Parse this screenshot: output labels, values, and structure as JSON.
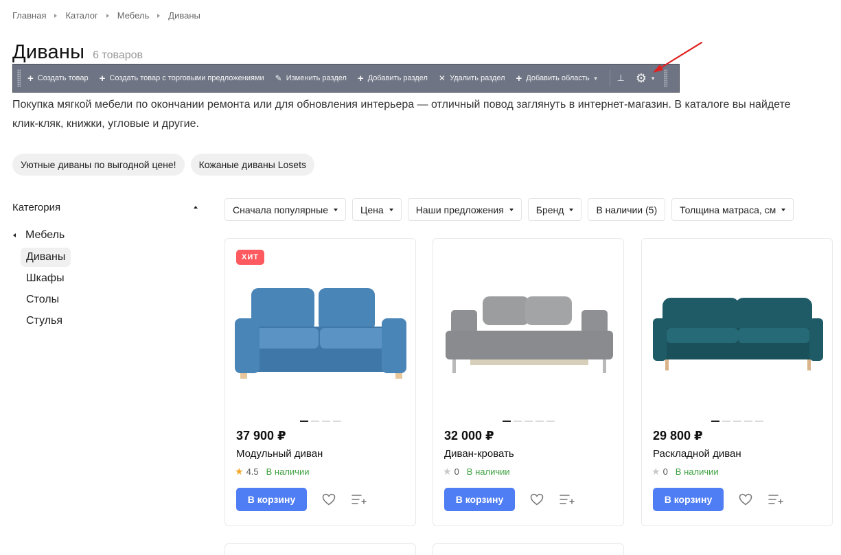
{
  "breadcrumb": [
    "Главная",
    "Каталог",
    "Мебель",
    "Диваны"
  ],
  "page": {
    "title": "Диваны",
    "count": "6 товаров"
  },
  "admin": {
    "items": [
      {
        "label": "Создать товар",
        "icon": "plus-icon"
      },
      {
        "label": "Создать товар с торговыми предложениями",
        "icon": "plus-icon"
      },
      {
        "label": "Изменить раздел",
        "icon": "pencil-icon"
      },
      {
        "label": "Добавить раздел",
        "icon": "plus-icon"
      },
      {
        "label": "Удалить раздел",
        "icon": "close-icon"
      },
      {
        "label": "Добавить область",
        "icon": "plus-icon"
      }
    ]
  },
  "description": "Покупка мягкой мебели по окончании ремонта или для обновления интерьера — отличный повод заглянуть в интернет-магазин. В каталоге вы найдете клик-кляк, книжки, угловые и другие.",
  "description_line1": "Покупка мягкой мебели по окончании ремонта или для обновления интерьера — отличный повод заглянуть в интернет-магазин. В каталоге вы найдете",
  "description_line2": "клик-кляк, книжки, угловые и другие.",
  "tags": [
    "Уютные диваны по выгодной цене!",
    "Кожаные диваны Losets"
  ],
  "sidebar": {
    "heading": "Категория",
    "root": "Мебель",
    "items": [
      "Диваны",
      "Шкафы",
      "Столы",
      "Стулья"
    ],
    "active": "Диваны"
  },
  "filters": [
    "Сначала популярные",
    "Цена",
    "Наши предложения",
    "Бренд",
    "В наличии (5)",
    "Толщина матраса, см"
  ],
  "products": [
    {
      "badge": "ХИТ",
      "price": "37 900 ₽",
      "name": "Модульный диван",
      "rating": "4.5",
      "stock": "В наличии",
      "button": "В корзину",
      "color": "#4a85b8",
      "dots": 4
    },
    {
      "badge": "",
      "price": "32 000 ₽",
      "name": "Диван-кровать",
      "rating": "0",
      "stock": "В наличии",
      "button": "В корзину",
      "color": "#8f9093",
      "dots": 5
    },
    {
      "badge": "",
      "price": "29 800 ₽",
      "name": "Раскладной диван",
      "rating": "0",
      "stock": "В наличии",
      "button": "В корзину",
      "color": "#1e5b66",
      "dots": 5
    }
  ],
  "colors": {
    "accent": "#4f7df3",
    "stock": "#3fa142",
    "badge": "#ff5a5f",
    "admin_bar": "#6e7483",
    "arrow": "#e0201f"
  }
}
